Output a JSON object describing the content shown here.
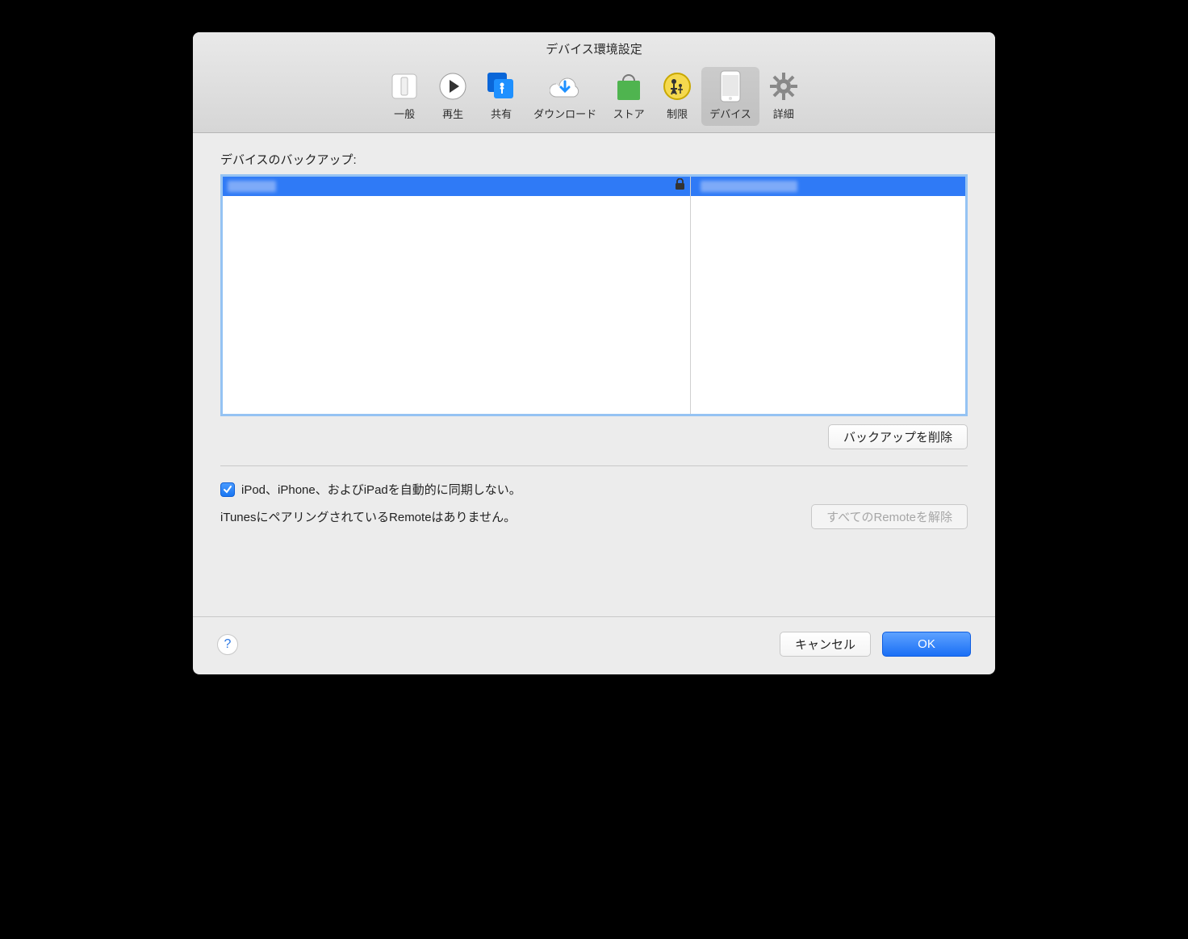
{
  "title": "デバイス環境設定",
  "toolbar": [
    {
      "label": "一般"
    },
    {
      "label": "再生"
    },
    {
      "label": "共有"
    },
    {
      "label": "ダウンロード"
    },
    {
      "label": "ストア"
    },
    {
      "label": "制限"
    },
    {
      "label": "デバイス",
      "selected": true
    },
    {
      "label": "詳細"
    }
  ],
  "section": {
    "backups_label": "デバイスのバックアップ:",
    "delete_backup": "バックアップを削除"
  },
  "checkbox": {
    "prevent_sync": "iPod、iPhone、およびiPadを自動的に同期しない。",
    "checked": true
  },
  "remote": {
    "status": "iTunesにペアリングされているRemoteはありません。",
    "unpair_all": "すべてのRemoteを解除"
  },
  "footer": {
    "cancel": "キャンセル",
    "ok": "OK"
  }
}
